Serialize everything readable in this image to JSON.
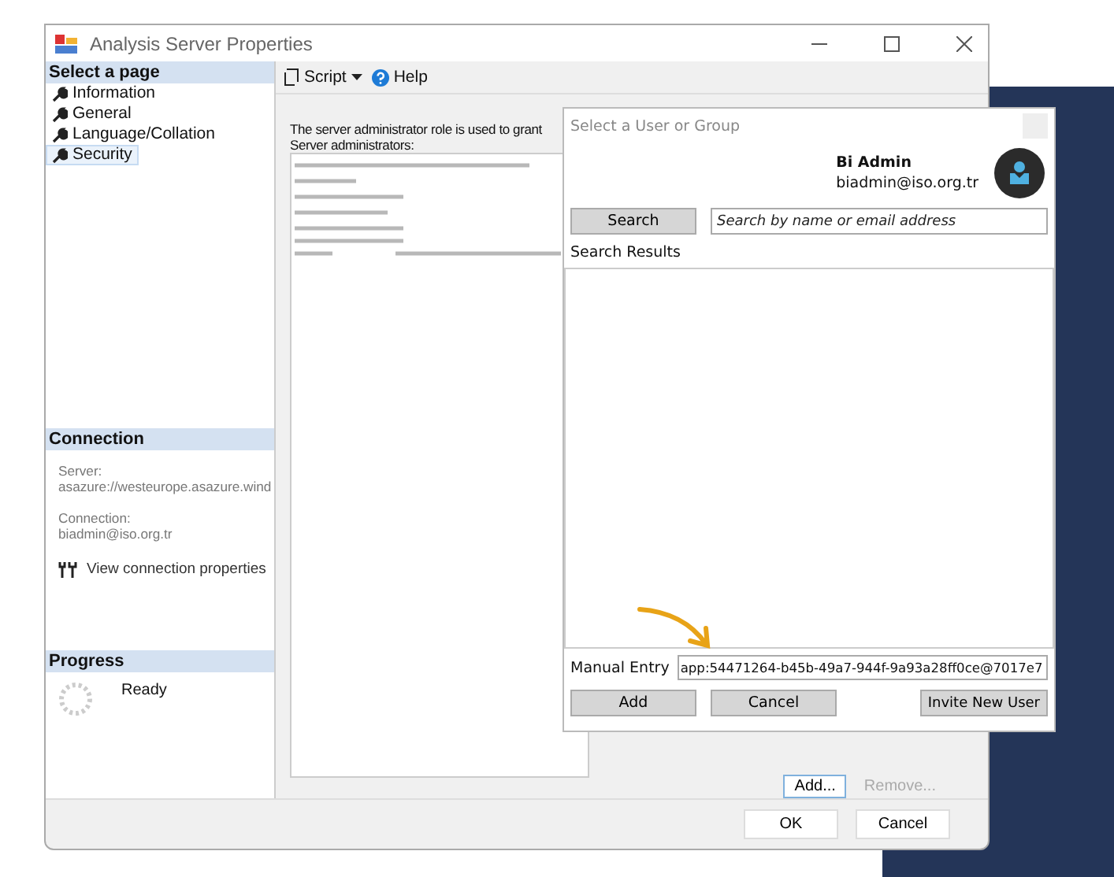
{
  "window": {
    "title": "Analysis Server Properties"
  },
  "sidebar": {
    "header": "Select a page",
    "items": [
      {
        "label": "Information",
        "selected": false
      },
      {
        "label": "General",
        "selected": false
      },
      {
        "label": "Language/Collation",
        "selected": false
      },
      {
        "label": "Security",
        "selected": true
      }
    ]
  },
  "connection": {
    "header": "Connection",
    "server_label": "Server:",
    "server": "asazure://westeurope.asazure.wind",
    "connection_label": "Connection:",
    "connection": "biadmin@iso.org.tr",
    "link": "View connection properties"
  },
  "progress": {
    "header": "Progress",
    "status": "Ready"
  },
  "toolbar": {
    "script": "Script",
    "help": "Help"
  },
  "content": {
    "description": "The server administrator role is used to grant",
    "list_label": "Server administrators:"
  },
  "list_buttons": [
    {
      "label": "Add...",
      "disabled": false
    },
    {
      "label": "Remove...",
      "disabled": true
    }
  ],
  "footer_buttons": [
    "OK",
    "Cancel"
  ],
  "dialog": {
    "title": "Select a User or Group",
    "user": {
      "name": "Bi Admin",
      "email": "biadmin@iso.org.tr"
    },
    "search_button": "Search",
    "search": {
      "placeholder": "Search by name or email address"
    },
    "results_label": "Search Results",
    "manual_entry": {
      "label": "Manual Entry",
      "value": "app:54471264-b45b-49a7-944f-9a93a28ff0ce@7017e7"
    },
    "buttons": [
      "Add",
      "Cancel",
      "Invite New User"
    ]
  }
}
